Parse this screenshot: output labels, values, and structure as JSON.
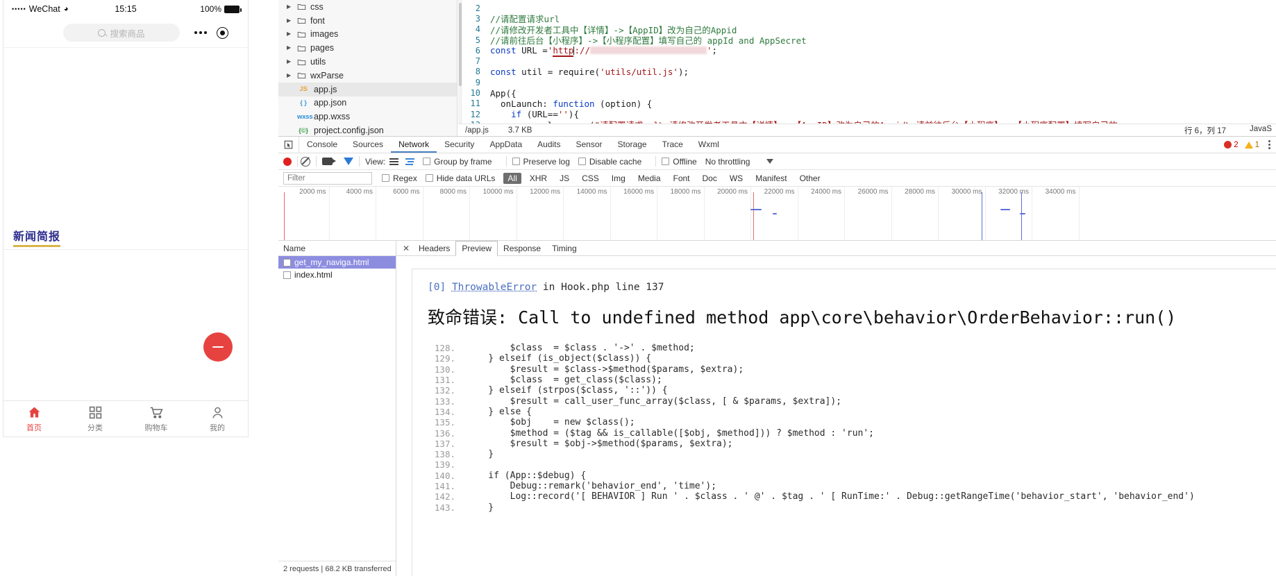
{
  "simulator": {
    "status": {
      "carrier": "WeChat",
      "dots": "•••••",
      "time": "15:15",
      "battery": "100%"
    },
    "navbar": {
      "search_placeholder": "搜索商品"
    },
    "content": {
      "news_badge": "新闻简报"
    },
    "tabbar": [
      {
        "label": "首页",
        "icon": "home-icon",
        "active": true
      },
      {
        "label": "分类",
        "icon": "grid-icon",
        "active": false
      },
      {
        "label": "购物车",
        "icon": "cart-icon",
        "active": false
      },
      {
        "label": "我的",
        "icon": "person-icon",
        "active": false
      }
    ]
  },
  "filetree": {
    "items": [
      {
        "name": "css",
        "type": "folder",
        "arrow": "▸",
        "selected": false
      },
      {
        "name": "font",
        "type": "folder",
        "arrow": "▸",
        "selected": false
      },
      {
        "name": "images",
        "type": "folder",
        "arrow": "▸",
        "selected": false
      },
      {
        "name": "pages",
        "type": "folder",
        "arrow": "▸",
        "selected": false
      },
      {
        "name": "utils",
        "type": "folder",
        "arrow": "▸",
        "selected": false
      },
      {
        "name": "wxParse",
        "type": "folder",
        "arrow": "▸",
        "selected": false
      },
      {
        "name": "app.js",
        "type": "file",
        "tag": "JS",
        "tag_color": "#e8a33d",
        "selected": true
      },
      {
        "name": "app.json",
        "type": "file",
        "tag": "{ }",
        "tag_color": "#3b9bd8",
        "selected": false
      },
      {
        "name": "app.wxss",
        "type": "file",
        "tag": "wxss",
        "tag_color": "#2b8fd8",
        "selected": false
      },
      {
        "name": "project.config.json",
        "type": "file",
        "tag": "{©}",
        "tag_color": "#3f9c4a",
        "selected": false
      }
    ]
  },
  "editor": {
    "lines": [
      {
        "no": "2",
        "segments": []
      },
      {
        "no": "3",
        "segments": [
          {
            "t": "//请配置请求url",
            "c": "k-comment"
          }
        ]
      },
      {
        "no": "4",
        "segments": [
          {
            "t": "//请修改开发者工具中【详情】->【AppID】改为自己的Appid",
            "c": "k-comment"
          }
        ]
      },
      {
        "no": "5",
        "segments": [
          {
            "t": "//请前往后台【小程序】->【小程序配置】填写自己的 appId and AppSecret",
            "c": "k-comment"
          }
        ]
      },
      {
        "no": "6",
        "segments": [
          {
            "t": "const",
            "c": "k-kw"
          },
          {
            "t": " URL =",
            "c": ""
          },
          {
            "t": "'",
            "c": "k-str"
          },
          {
            "t": "http",
            "c": "url"
          },
          {
            "t": "://",
            "c": "k-str"
          },
          {
            "t": "REDACT",
            "c": "redact"
          },
          {
            "t": "'",
            "c": "k-str"
          },
          {
            "t": ";",
            "c": ""
          }
        ]
      },
      {
        "no": "7",
        "segments": []
      },
      {
        "no": "8",
        "segments": [
          {
            "t": "const",
            "c": "k-kw"
          },
          {
            "t": " util = require(",
            "c": ""
          },
          {
            "t": "'utils/util.js'",
            "c": "k-str"
          },
          {
            "t": ");",
            "c": ""
          }
        ]
      },
      {
        "no": "9",
        "segments": []
      },
      {
        "no": "10",
        "segments": [
          {
            "t": "App({",
            "c": ""
          }
        ]
      },
      {
        "no": "11",
        "segments": [
          {
            "t": "  onLaunch: ",
            "c": ""
          },
          {
            "t": "function",
            "c": "k-kw"
          },
          {
            "t": " (option) {",
            "c": ""
          }
        ]
      },
      {
        "no": "12",
        "segments": [
          {
            "t": "    ",
            "c": ""
          },
          {
            "t": "if",
            "c": "k-kw"
          },
          {
            "t": " (URL==",
            "c": ""
          },
          {
            "t": "''",
            "c": "k-str"
          },
          {
            "t": "){",
            "c": ""
          }
        ]
      },
      {
        "no": "13",
        "segments": [
          {
            "t": "      console.error(",
            "c": ""
          },
          {
            "t": "\"请配置请求url\\n请修改开发者工具中【详情】->【AppID】改为自己的Appid\\n请前往后台【小程序】->【小程序配置】填写自己的",
            "c": "k-str"
          }
        ]
      }
    ],
    "status": {
      "file": "/app.js",
      "size": "3.7 KB",
      "cursor": "行 6，列 17",
      "language": "JavaS"
    }
  },
  "devtools": {
    "tabs": [
      {
        "label": "Console",
        "active": false
      },
      {
        "label": "Sources",
        "active": false
      },
      {
        "label": "Network",
        "active": true
      },
      {
        "label": "Security",
        "active": false
      },
      {
        "label": "AppData",
        "active": false
      },
      {
        "label": "Audits",
        "active": false
      },
      {
        "label": "Sensor",
        "active": false
      },
      {
        "label": "Storage",
        "active": false
      },
      {
        "label": "Trace",
        "active": false
      },
      {
        "label": "Wxml",
        "active": false
      }
    ],
    "counters": {
      "errors": "2",
      "warnings": "1"
    },
    "toolbar": {
      "view_label": "View:",
      "group_by_frame": "Group by frame",
      "preserve_log": "Preserve log",
      "disable_cache": "Disable cache",
      "offline": "Offline",
      "throttling": "No throttling"
    },
    "filterbar": {
      "filter_placeholder": "Filter",
      "regex": "Regex",
      "hide_data_urls": "Hide data URLs",
      "types": [
        {
          "label": "All",
          "active": true
        },
        {
          "label": "XHR",
          "active": false
        },
        {
          "label": "JS",
          "active": false
        },
        {
          "label": "CSS",
          "active": false
        },
        {
          "label": "Img",
          "active": false
        },
        {
          "label": "Media",
          "active": false
        },
        {
          "label": "Font",
          "active": false
        },
        {
          "label": "Doc",
          "active": false
        },
        {
          "label": "WS",
          "active": false
        },
        {
          "label": "Manifest",
          "active": false
        },
        {
          "label": "Other",
          "active": false
        }
      ]
    },
    "timeline": {
      "ticks": [
        "2000 ms",
        "4000 ms",
        "6000 ms",
        "8000 ms",
        "10000 ms",
        "12000 ms",
        "14000 ms",
        "16000 ms",
        "18000 ms",
        "20000 ms",
        "22000 ms",
        "24000 ms",
        "26000 ms",
        "28000 ms",
        "30000 ms",
        "32000 ms",
        "34000 ms"
      ]
    },
    "requests": {
      "header": "Name",
      "rows": [
        {
          "name": "get_my_naviga.html",
          "selected": true
        },
        {
          "name": "index.html",
          "selected": false
        }
      ],
      "footer": "2 requests | 68.2 KB transferred"
    },
    "detail": {
      "tabs": [
        {
          "label": "Headers",
          "active": false
        },
        {
          "label": "Preview",
          "active": true
        },
        {
          "label": "Response",
          "active": false
        },
        {
          "label": "Timing",
          "active": false
        }
      ],
      "preview": {
        "header_bracket": "[0]",
        "header_error": "ThrowableError",
        "header_in": "in",
        "header_file": "Hook.php line 137",
        "title": "致命错误: Call to undefined method app\\core\\behavior\\OrderBehavior::run()",
        "source": [
          {
            "no": "128.",
            "code": "        $class  = $class . '->' . $method;"
          },
          {
            "no": "129.",
            "code": "    } elseif (is_object($class)) {"
          },
          {
            "no": "130.",
            "code": "        $result = $class->$method($params, $extra);"
          },
          {
            "no": "131.",
            "code": "        $class  = get_class($class);"
          },
          {
            "no": "132.",
            "code": "    } elseif (strpos($class, '::')) {"
          },
          {
            "no": "133.",
            "code": "        $result = call_user_func_array($class, [ & $params, $extra]);"
          },
          {
            "no": "134.",
            "code": "    } else {"
          },
          {
            "no": "135.",
            "code": "        $obj    = new $class();"
          },
          {
            "no": "136.",
            "code": "        $method = ($tag && is_callable([$obj, $method])) ? $method : 'run';"
          },
          {
            "no": "137.",
            "code": "        $result = $obj->$method($params, $extra);"
          },
          {
            "no": "138.",
            "code": "    }"
          },
          {
            "no": "139.",
            "code": ""
          },
          {
            "no": "140.",
            "code": "    if (App::$debug) {"
          },
          {
            "no": "141.",
            "code": "        Debug::remark('behavior_end', 'time');"
          },
          {
            "no": "142.",
            "code": "        Log::record('[ BEHAVIOR ] Run ' . $class . ' @' . $tag . ' [ RunTime:' . Debug::getRangeTime('behavior_start', 'behavior_end')"
          },
          {
            "no": "143.",
            "code": "    }"
          }
        ]
      }
    }
  },
  "colors": {
    "accent_red": "#e64340",
    "tab_active": "#4a7fc1",
    "selection": "#8d8de0"
  }
}
